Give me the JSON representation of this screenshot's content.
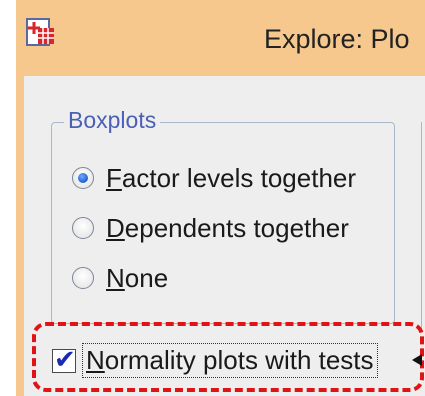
{
  "window": {
    "title": "Explore: Plo"
  },
  "boxplots": {
    "legend": "Boxplots",
    "options": [
      {
        "mnemonic": "F",
        "rest": "actor levels together",
        "checked": true
      },
      {
        "mnemonic": "D",
        "rest": "ependents together",
        "checked": false
      },
      {
        "mnemonic": "N",
        "rest": "one",
        "checked": false
      }
    ]
  },
  "normality": {
    "mnemonic": "N",
    "rest": "ormality plots with tests",
    "checked": true
  },
  "colors": {
    "title_bar": "#f6c88e",
    "highlight": "#e01414",
    "legend_text": "#4a5fb5"
  }
}
